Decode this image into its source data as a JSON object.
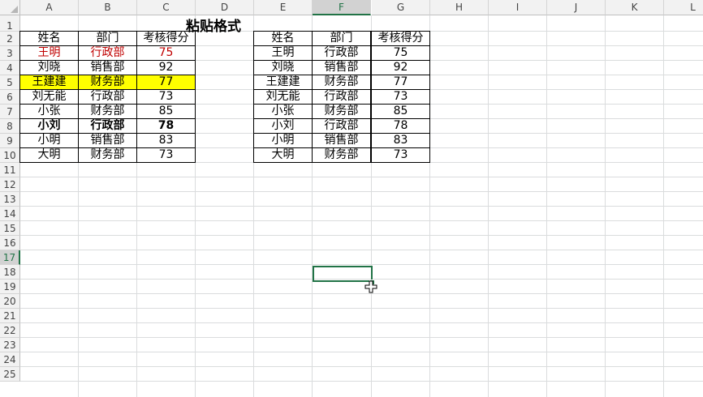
{
  "columns": [
    "A",
    "B",
    "C",
    "D",
    "E",
    "F",
    "G",
    "H",
    "I",
    "J",
    "K",
    "L"
  ],
  "rows": [
    "1",
    "2",
    "3",
    "4",
    "5",
    "6",
    "7",
    "8",
    "9",
    "10",
    "11",
    "12",
    "13",
    "14",
    "15",
    "16",
    "17",
    "18",
    "19",
    "20",
    "21",
    "22",
    "23",
    "24",
    "25"
  ],
  "selected_column": "F",
  "selected_row": "17",
  "title": "粘贴格式",
  "left_table": {
    "headers": [
      "姓名",
      "部门",
      "考核得分"
    ],
    "rows": [
      [
        "王明",
        "行政部",
        "75"
      ],
      [
        "刘晓",
        "销售部",
        "92"
      ],
      [
        "王建建",
        "财务部",
        "77"
      ],
      [
        "刘无能",
        "行政部",
        "73"
      ],
      [
        "小张",
        "财务部",
        "85"
      ],
      [
        "小刘",
        "行政部",
        "78"
      ],
      [
        "小明",
        "销售部",
        "83"
      ],
      [
        "大明",
        "财务部",
        "73"
      ]
    ],
    "row_styles": [
      "red",
      "",
      "yellow",
      "",
      "",
      "bold",
      "",
      ""
    ]
  },
  "right_table": {
    "headers": [
      "姓名",
      "部门",
      "考核得分"
    ],
    "rows": [
      [
        "王明",
        "行政部",
        "75"
      ],
      [
        "刘晓",
        "销售部",
        "92"
      ],
      [
        "王建建",
        "财务部",
        "77"
      ],
      [
        "刘无能",
        "行政部",
        "73"
      ],
      [
        "小张",
        "财务部",
        "85"
      ],
      [
        "小刘",
        "行政部",
        "78"
      ],
      [
        "小明",
        "销售部",
        "83"
      ],
      [
        "大明",
        "财务部",
        "73"
      ]
    ]
  },
  "colors": {
    "accent": "#217346",
    "highlight": "#ffff00",
    "red_text": "#c00000"
  },
  "cursor_icon": "move-cross-icon"
}
